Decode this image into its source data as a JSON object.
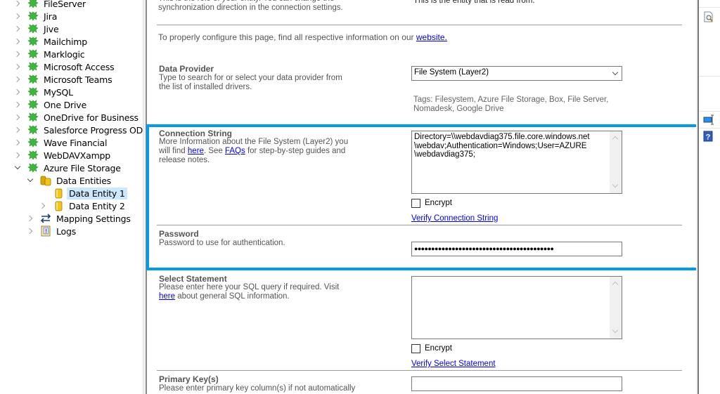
{
  "tree": {
    "items": [
      {
        "label": "FileServer",
        "icon": "plugin-icon",
        "expanded": false,
        "level": 0,
        "partial": true
      },
      {
        "label": "Jira",
        "icon": "plugin-icon",
        "expanded": false,
        "level": 0
      },
      {
        "label": "Jive",
        "icon": "plugin-icon",
        "expanded": false,
        "level": 0
      },
      {
        "label": "Mailchimp",
        "icon": "plugin-icon",
        "expanded": false,
        "level": 0
      },
      {
        "label": "Marklogic",
        "icon": "plugin-icon",
        "expanded": false,
        "level": 0
      },
      {
        "label": "Microsoft Access",
        "icon": "plugin-icon",
        "expanded": false,
        "level": 0
      },
      {
        "label": "Microsoft Teams",
        "icon": "plugin-icon",
        "expanded": false,
        "level": 0
      },
      {
        "label": "MySQL",
        "icon": "plugin-icon",
        "expanded": false,
        "level": 0
      },
      {
        "label": "One Drive",
        "icon": "plugin-icon",
        "expanded": false,
        "level": 0
      },
      {
        "label": "OneDrive for Business",
        "icon": "plugin-icon",
        "expanded": false,
        "level": 0
      },
      {
        "label": "Salesforce Progress ODBC",
        "icon": "plugin-icon",
        "expanded": false,
        "level": 0
      },
      {
        "label": "Wave Financial",
        "icon": "plugin-icon",
        "expanded": false,
        "level": 0
      },
      {
        "label": "WebDAVXampp",
        "icon": "plugin-icon",
        "expanded": false,
        "level": 0
      },
      {
        "label": "Azure File Storage",
        "icon": "plugin-icon",
        "expanded": true,
        "level": 0
      },
      {
        "label": "Data Entities",
        "icon": "database-group-icon",
        "expanded": true,
        "level": 1
      },
      {
        "label": "Data Entity 1",
        "icon": "database-icon",
        "expanded": null,
        "level": 2,
        "selected": true
      },
      {
        "label": "Data Entity 2",
        "icon": "database-icon",
        "expanded": false,
        "level": 2
      },
      {
        "label": "Mapping Settings",
        "icon": "mapping-arrows-icon",
        "expanded": false,
        "level": 1
      },
      {
        "label": "Logs",
        "icon": "log-book-icon",
        "expanded": false,
        "level": 1
      }
    ]
  },
  "form": {
    "top_desc_line1": "This is the role of your entity. You can change the",
    "top_desc_line2": "synchronization direction in the connection settings.",
    "top_right_text": "This is the entity that is read from.",
    "config_note": "To properly configure this page, find all respective information on our ",
    "config_link": "website.",
    "data_provider": {
      "title": "Data Provider",
      "desc": "Type to search for or select your data provider from the list of installed drivers.",
      "value": "File System (Layer2)",
      "tags_line1": "Tags: Filesystem, Azure File Storage, Box, File Server,",
      "tags_line2": "Nomadesk, Google Drive"
    },
    "connection_string": {
      "title": "Connection String",
      "desc_part1": "More Information about the File System (Layer2) you will find ",
      "desc_link1": "here",
      "desc_part2": ". See ",
      "desc_link2": "FAQs",
      "desc_part3": " for step-by-step guides and release notes.",
      "value_line1": "Directory=\\\\webdavdiag375.file.core.windows.net",
      "value_line2": "\\webdav;Authentication=Windows;User=AZURE",
      "value_line3": "\\webdavdiag375;",
      "encrypt_label": "Encrypt",
      "encrypt_checked": false,
      "verify_link": "Verify Connection String"
    },
    "password": {
      "title": "Password",
      "desc": "Password to use for authentication.",
      "masked_value": "●●●●●●●●●●●●●●●●●●●●●●●●●●●●●●●●●●●●●●●●●"
    },
    "select_statement": {
      "title": "Select Statement",
      "desc_part1": "Please enter here your SQL query if required. Visit ",
      "desc_link": "here",
      "desc_part2": " about general SQL information.",
      "value": "",
      "encrypt_label": "Encrypt",
      "encrypt_checked": false,
      "verify_link": "Verify Select Statement"
    },
    "primary_keys": {
      "title": "Primary Key(s)",
      "desc": "Please enter primary key column(s) if not automatically",
      "value": ""
    }
  },
  "right_strip": {
    "icons": [
      "preview-document-icon",
      "text-field-icon",
      "help-icon"
    ]
  },
  "colors": {
    "highlight": "#039be5",
    "link": "#0000ee",
    "selection": "#cce8ff",
    "plugin_green": "#3cb83c"
  }
}
